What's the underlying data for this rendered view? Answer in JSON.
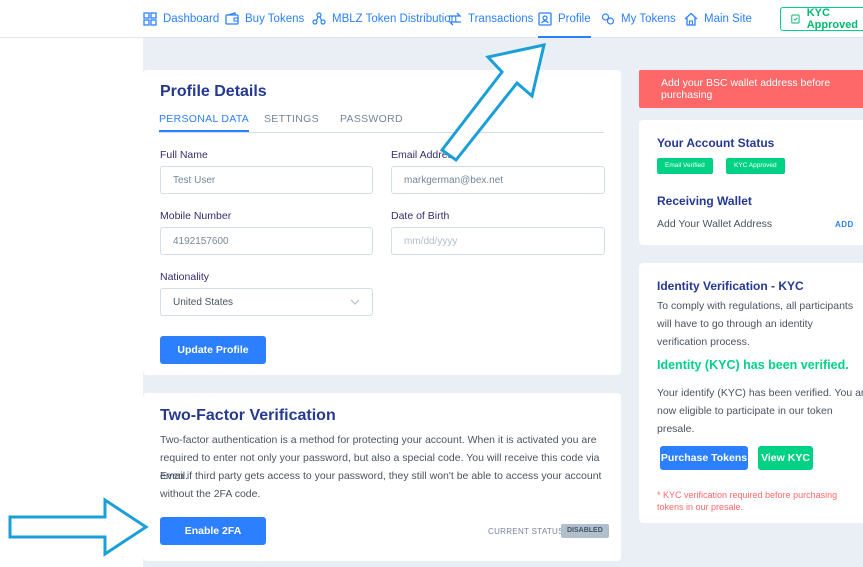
{
  "nav": {
    "items": [
      {
        "label": "Dashboard",
        "icon": "dashboard-icon"
      },
      {
        "label": "Buy Tokens",
        "icon": "wallet-icon"
      },
      {
        "label": "MBLZ Token Distribution",
        "icon": "distribution-icon"
      },
      {
        "label": "Transactions",
        "icon": "transfer-icon"
      },
      {
        "label": "Profile",
        "icon": "profile-icon"
      },
      {
        "label": "My Tokens",
        "icon": "tokens-icon"
      },
      {
        "label": "Main Site",
        "icon": "home-icon"
      }
    ],
    "kyc_label": "KYC Approved"
  },
  "profile": {
    "title": "Profile Details",
    "tabs": [
      "PERSONAL DATA",
      "SETTINGS",
      "PASSWORD"
    ],
    "full_name_label": "Full Name",
    "full_name_value": "Test User",
    "email_label": "Email Address",
    "email_value": "markgerman@bex.net",
    "mobile_label": "Mobile Number",
    "mobile_value": "4192157600",
    "dob_label": "Date of Birth",
    "dob_placeholder": "mm/dd/yyyy",
    "nationality_label": "Nationality",
    "nationality_value": "United States",
    "update_button": "Update Profile"
  },
  "twofa": {
    "title": "Two-Factor Verification",
    "line1": "Two-factor authentication is a method for protecting your account. When it is activated you are",
    "line2": "required to enter not only your password, but also a special code. You will receive this code via email.",
    "line3": "Even if third party gets access to your password, they still won't be able to access your account",
    "line4": "without the 2FA code.",
    "enable_button": "Enable 2FA",
    "status_label": "CURRENT STATUS:",
    "status_value": "DISABLED"
  },
  "sidebar": {
    "alert": "Add your BSC wallet address before purchasing",
    "account_status_title": "Your Account Status",
    "badge_email": "Email Verified",
    "badge_kyc": "KYC Approved",
    "receiving_wallet_title": "Receiving Wallet",
    "wallet_text": "Add Your Wallet Address",
    "add_link": "ADD",
    "kyc_title": "Identity Verification - KYC",
    "kyc_line1": "To comply with regulations, all participants",
    "kyc_line2": "will have to go through an identity",
    "kyc_line3": "verification process.",
    "kyc_verified": "Identity (KYC) has been verified.",
    "kyc_desc1": "Your identify (KYC) has been verified. You are",
    "kyc_desc2": "now eligible to participate in our token",
    "kyc_desc3": "presale.",
    "purchase_button": "Purchase Tokens",
    "view_kyc_button": "View KYC",
    "warn1": "* KYC verification required before purchasing",
    "warn2": "tokens in our presale."
  },
  "colors": {
    "accent": "#2c80ff",
    "success": "#00d285",
    "danger": "#ff6868",
    "heading": "#253992"
  }
}
